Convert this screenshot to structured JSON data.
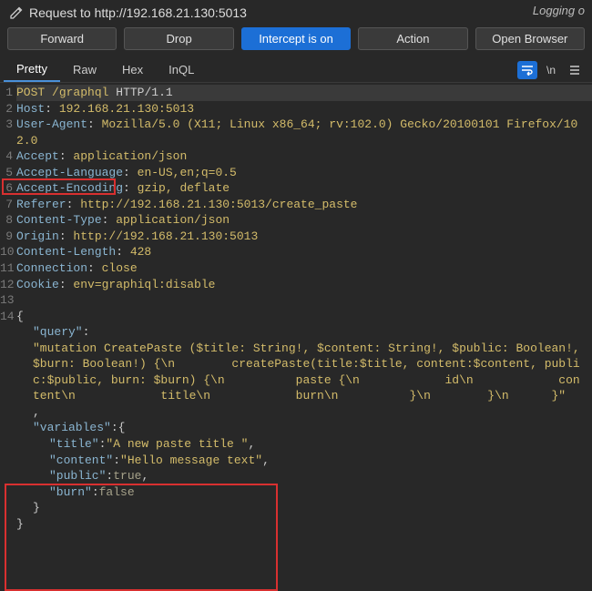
{
  "topRight": "Logging o",
  "title": "Request to http://192.168.21.130:5013",
  "buttons": {
    "forward": "Forward",
    "drop": "Drop",
    "intercept": "Intercept is on",
    "action": "Action",
    "openBrowser": "Open Browser"
  },
  "tabs": {
    "pretty": "Pretty",
    "raw": "Raw",
    "hex": "Hex",
    "inql": "InQL"
  },
  "request": {
    "method": "POST",
    "path": "/graphql",
    "protocol": "HTTP/1.1",
    "headers": {
      "Host": "192.168.21.130:5013",
      "UserAgent": "Mozilla/5.0 (X11; Linux x86_64; rv:102.0) Gecko/20100101 Firefox/102.0",
      "Accept": "application/json",
      "AcceptLanguage": "en-US,en;q=0.5",
      "AcceptEncoding": "gzip, deflate",
      "Referer": "http://192.168.21.130:5013/create_paste",
      "ContentType": "application/json",
      "Origin": "http://192.168.21.130:5013",
      "ContentLength": "428",
      "Connection": "close",
      "Cookie": "env=graphiql:disable"
    },
    "body": {
      "queryLabel": "\"query\"",
      "queryValue": "\"mutation CreatePaste ($title: String!, $content: String!, $public: Boolean!, $burn: Boolean!) {\\n        createPaste(title:$title, content:$content, public:$public, burn: $burn) {\\n          paste {\\n            id\\n            content\\n            title\\n            burn\\n          }\\n        }\\n      }\"",
      "varsLabel": "\"variables\"",
      "vars": {
        "titleKey": "\"title\"",
        "titleVal": "\"A new paste title \"",
        "contentKey": "\"content\"",
        "contentVal": "\"Hello message text\"",
        "publicKey": "\"public\"",
        "publicVal": "true",
        "burnKey": "\"burn\"",
        "burnVal": "false"
      }
    }
  },
  "headerLabels": {
    "Host": "Host",
    "UserAgent": "User-Agent",
    "Accept": "Accept",
    "AcceptLanguage": "Accept-Language",
    "AcceptEncoding": "Accept-Encoding",
    "Referer": "Referer",
    "ContentType": "Content-Type",
    "Origin": "Origin",
    "ContentLength": "Content-Length",
    "Connection": "Connection",
    "Cookie": "Cookie"
  }
}
